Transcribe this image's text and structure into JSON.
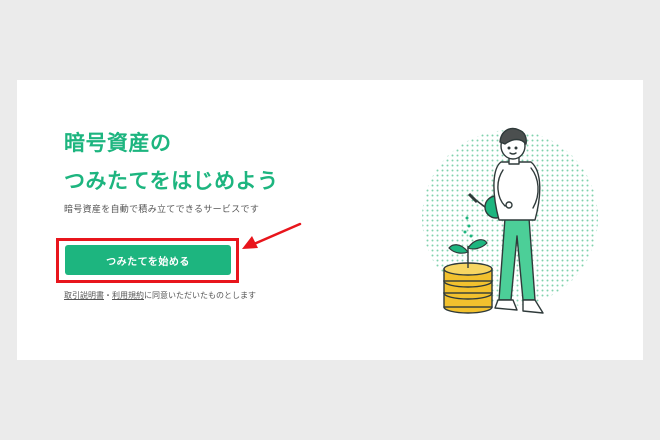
{
  "hero": {
    "headline_line1": "暗号資産の",
    "headline_line2": "つみたてをはじめよう",
    "subtext": "暗号資産を自動で積み立てできるサービスです",
    "cta_label": "つみたてを始める",
    "consent": {
      "link1": "取引説明書",
      "separator": "・",
      "link2": "利用規約",
      "suffix": "に同意いただいたものとします"
    }
  },
  "illustration": {
    "icon": "person-watering-coin-plant-illustration"
  },
  "colors": {
    "accent": "#1db57f",
    "highlight": "#e8151c",
    "coin": "#f2c12e"
  }
}
